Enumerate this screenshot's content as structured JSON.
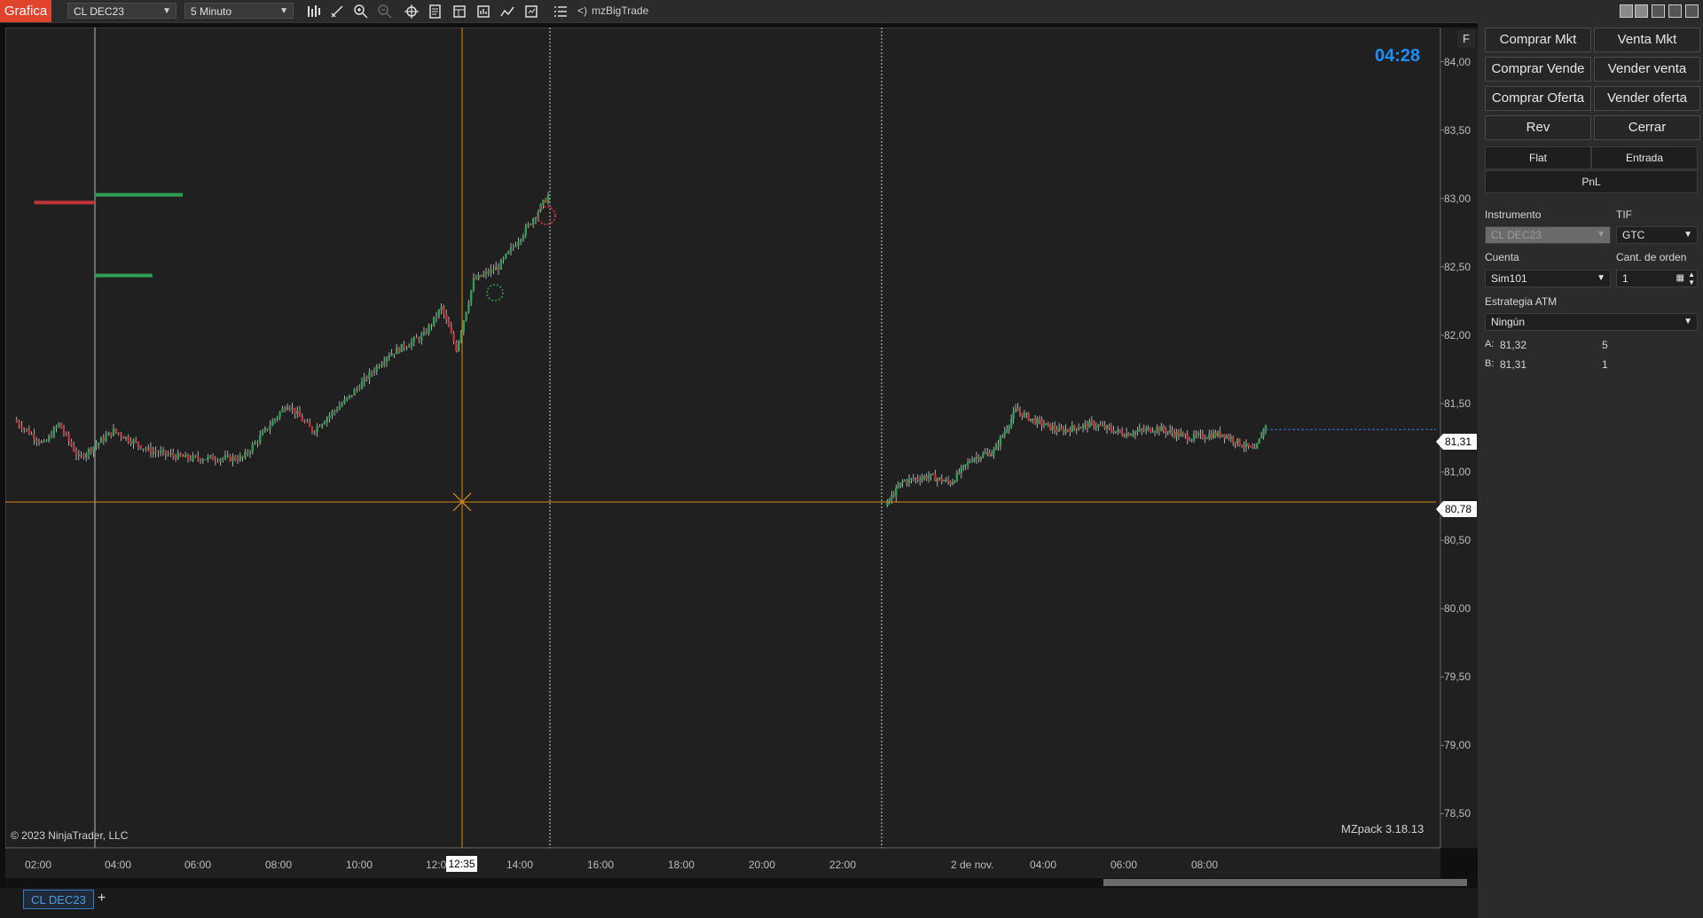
{
  "toolbar": {
    "app_tab": "Grafica",
    "instrument": "CL DEC23",
    "interval": "5 Minuto",
    "indicator": "mzBigTrade",
    "indicator_prefix": "<)"
  },
  "chart": {
    "timer": "04:28",
    "f_button": "F",
    "copyright": "© 2023 NinjaTrader, LLC",
    "watermark": "MZpack 3.18.13",
    "price_ticks": [
      "84,00",
      "83,50",
      "83,00",
      "82,50",
      "82,00",
      "81,50",
      "81,00",
      "80,50",
      "80,00",
      "79,50",
      "79,00",
      "78,50"
    ],
    "time_ticks": [
      "02:00",
      "04:00",
      "06:00",
      "08:00",
      "10:00",
      "12:00",
      "14:00",
      "16:00",
      "18:00",
      "20:00",
      "22:00",
      "2 de nov.",
      "04:00",
      "06:00",
      "08:00"
    ],
    "last_price_tag": "81,31",
    "crosshair_price_tag": "80,78",
    "crosshair_time_tag": "12:35",
    "colors": {
      "up": "#2e9e55",
      "down": "#c0343a",
      "crosshair": "#d88a1a",
      "lastline": "#3a6fd8",
      "background": "#202020"
    }
  },
  "chart_data": {
    "type": "candlestick",
    "instrument": "CL DEC23",
    "interval": "5 Minuto",
    "ylim": [
      78.25,
      84.25
    ],
    "sessions": [
      {
        "start_label": "01:30",
        "end_label": "14:45",
        "key_points": [
          [
            0,
            81.38
          ],
          [
            12,
            81.2
          ],
          [
            18,
            81.35
          ],
          [
            26,
            81.1
          ],
          [
            40,
            81.3
          ],
          [
            55,
            81.15
          ],
          [
            70,
            81.1
          ],
          [
            92,
            81.1
          ],
          [
            110,
            81.5
          ],
          [
            120,
            81.3
          ],
          [
            135,
            81.55
          ],
          [
            150,
            81.85
          ],
          [
            165,
            82.0
          ],
          [
            172,
            82.2
          ],
          [
            178,
            81.9
          ],
          [
            185,
            82.4
          ],
          [
            195,
            82.5
          ],
          [
            207,
            82.8
          ],
          [
            215,
            83.02
          ]
        ]
      },
      {
        "start_label": "23:00",
        "end_label": "09:30",
        "key_points": [
          [
            0,
            80.75
          ],
          [
            8,
            80.93
          ],
          [
            20,
            80.97
          ],
          [
            30,
            80.92
          ],
          [
            40,
            81.1
          ],
          [
            50,
            81.15
          ],
          [
            60,
            81.45
          ],
          [
            68,
            81.38
          ],
          [
            80,
            81.3
          ],
          [
            95,
            81.35
          ],
          [
            110,
            81.28
          ],
          [
            125,
            81.32
          ],
          [
            140,
            81.25
          ],
          [
            155,
            81.28
          ],
          [
            170,
            81.15
          ],
          [
            175,
            81.35
          ]
        ]
      }
    ],
    "volume_profile_levels": [
      {
        "price": 83.02,
        "buy": 0.55,
        "sell": 0.0
      },
      {
        "price": 82.97,
        "buy": 0.0,
        "sell": 0.38
      },
      {
        "price": 82.43,
        "buy": 0.36,
        "sell": 0.0
      }
    ]
  },
  "order_panel": {
    "buttons": [
      "Comprar Mkt",
      "Venta Mkt",
      "Comprar Vende",
      "Vender venta",
      "Comprar Oferta",
      "Vender oferta",
      "Rev",
      "Cerrar"
    ],
    "position": {
      "flat": "Flat",
      "entrada": "Entrada",
      "pnl": "PnL"
    },
    "instrumento_label": "Instrumento",
    "instrumento_value": "CL DEC23",
    "tif_label": "TIF",
    "tif_value": "GTC",
    "cuenta_label": "Cuenta",
    "cuenta_value": "Sim101",
    "cant_label": "Cant. de orden",
    "cant_value": "1",
    "atm_label": "Estrategia ATM",
    "atm_value": "Ningún",
    "ask_label": "A:",
    "ask_price": "81,32",
    "ask_size": "5",
    "bid_label": "B:",
    "bid_price": "81,31",
    "bid_size": "1"
  },
  "bottom": {
    "tab": "CL DEC23",
    "add": "+"
  }
}
